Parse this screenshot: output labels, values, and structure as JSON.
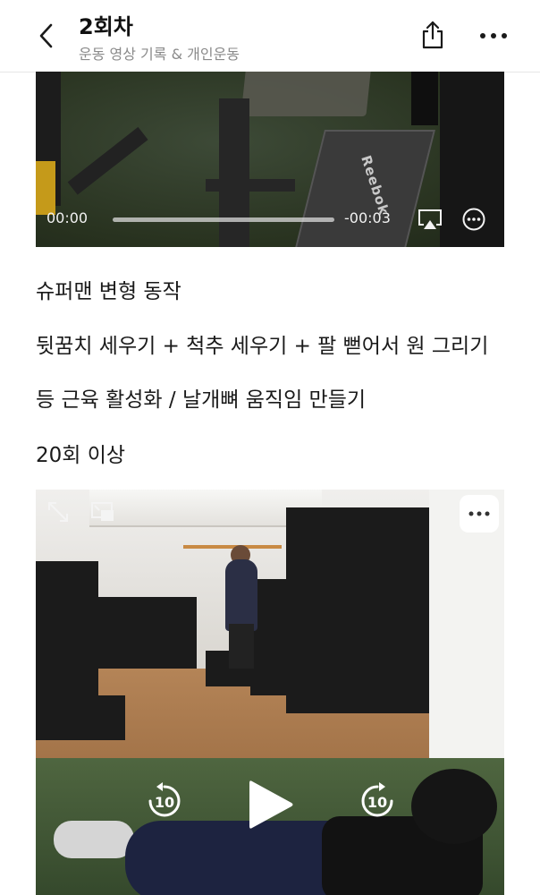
{
  "header": {
    "title": "2회차",
    "subtitle": "운동 영상 기록 & 개인운동",
    "back_icon": "chevron-left-icon",
    "share_icon": "share-icon",
    "more_icon": "ellipsis-icon"
  },
  "video1": {
    "current_time": "00:00",
    "remaining_time": "-00:03",
    "progress": 0.0,
    "bench_text": "Reebok"
  },
  "content": {
    "lines": [
      "슈퍼맨 변형 동작",
      "뒷꿈치 세우기 + 척추 세우기 + 팔 뻗어서 원 그리기",
      "등 근육 활성화 / 날개뼈 움직임 만들기",
      "20회 이상"
    ]
  },
  "video2": {
    "rewind_seconds": "10",
    "forward_seconds": "10",
    "playing": false
  }
}
